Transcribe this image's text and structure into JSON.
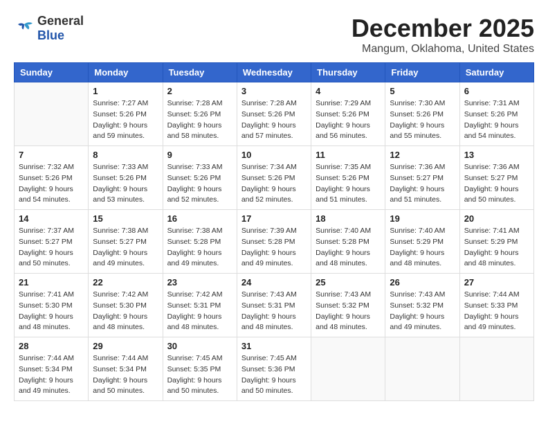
{
  "logo": {
    "general": "General",
    "blue": "Blue"
  },
  "title": {
    "month": "December 2025",
    "location": "Mangum, Oklahoma, United States"
  },
  "headers": [
    "Sunday",
    "Monday",
    "Tuesday",
    "Wednesday",
    "Thursday",
    "Friday",
    "Saturday"
  ],
  "weeks": [
    [
      {
        "day": "",
        "info": ""
      },
      {
        "day": "1",
        "info": "Sunrise: 7:27 AM\nSunset: 5:26 PM\nDaylight: 9 hours\nand 59 minutes."
      },
      {
        "day": "2",
        "info": "Sunrise: 7:28 AM\nSunset: 5:26 PM\nDaylight: 9 hours\nand 58 minutes."
      },
      {
        "day": "3",
        "info": "Sunrise: 7:28 AM\nSunset: 5:26 PM\nDaylight: 9 hours\nand 57 minutes."
      },
      {
        "day": "4",
        "info": "Sunrise: 7:29 AM\nSunset: 5:26 PM\nDaylight: 9 hours\nand 56 minutes."
      },
      {
        "day": "5",
        "info": "Sunrise: 7:30 AM\nSunset: 5:26 PM\nDaylight: 9 hours\nand 55 minutes."
      },
      {
        "day": "6",
        "info": "Sunrise: 7:31 AM\nSunset: 5:26 PM\nDaylight: 9 hours\nand 54 minutes."
      }
    ],
    [
      {
        "day": "7",
        "info": "Sunrise: 7:32 AM\nSunset: 5:26 PM\nDaylight: 9 hours\nand 54 minutes."
      },
      {
        "day": "8",
        "info": "Sunrise: 7:33 AM\nSunset: 5:26 PM\nDaylight: 9 hours\nand 53 minutes."
      },
      {
        "day": "9",
        "info": "Sunrise: 7:33 AM\nSunset: 5:26 PM\nDaylight: 9 hours\nand 52 minutes."
      },
      {
        "day": "10",
        "info": "Sunrise: 7:34 AM\nSunset: 5:26 PM\nDaylight: 9 hours\nand 52 minutes."
      },
      {
        "day": "11",
        "info": "Sunrise: 7:35 AM\nSunset: 5:26 PM\nDaylight: 9 hours\nand 51 minutes."
      },
      {
        "day": "12",
        "info": "Sunrise: 7:36 AM\nSunset: 5:27 PM\nDaylight: 9 hours\nand 51 minutes."
      },
      {
        "day": "13",
        "info": "Sunrise: 7:36 AM\nSunset: 5:27 PM\nDaylight: 9 hours\nand 50 minutes."
      }
    ],
    [
      {
        "day": "14",
        "info": "Sunrise: 7:37 AM\nSunset: 5:27 PM\nDaylight: 9 hours\nand 50 minutes."
      },
      {
        "day": "15",
        "info": "Sunrise: 7:38 AM\nSunset: 5:27 PM\nDaylight: 9 hours\nand 49 minutes."
      },
      {
        "day": "16",
        "info": "Sunrise: 7:38 AM\nSunset: 5:28 PM\nDaylight: 9 hours\nand 49 minutes."
      },
      {
        "day": "17",
        "info": "Sunrise: 7:39 AM\nSunset: 5:28 PM\nDaylight: 9 hours\nand 49 minutes."
      },
      {
        "day": "18",
        "info": "Sunrise: 7:40 AM\nSunset: 5:28 PM\nDaylight: 9 hours\nand 48 minutes."
      },
      {
        "day": "19",
        "info": "Sunrise: 7:40 AM\nSunset: 5:29 PM\nDaylight: 9 hours\nand 48 minutes."
      },
      {
        "day": "20",
        "info": "Sunrise: 7:41 AM\nSunset: 5:29 PM\nDaylight: 9 hours\nand 48 minutes."
      }
    ],
    [
      {
        "day": "21",
        "info": "Sunrise: 7:41 AM\nSunset: 5:30 PM\nDaylight: 9 hours\nand 48 minutes."
      },
      {
        "day": "22",
        "info": "Sunrise: 7:42 AM\nSunset: 5:30 PM\nDaylight: 9 hours\nand 48 minutes."
      },
      {
        "day": "23",
        "info": "Sunrise: 7:42 AM\nSunset: 5:31 PM\nDaylight: 9 hours\nand 48 minutes."
      },
      {
        "day": "24",
        "info": "Sunrise: 7:43 AM\nSunset: 5:31 PM\nDaylight: 9 hours\nand 48 minutes."
      },
      {
        "day": "25",
        "info": "Sunrise: 7:43 AM\nSunset: 5:32 PM\nDaylight: 9 hours\nand 48 minutes."
      },
      {
        "day": "26",
        "info": "Sunrise: 7:43 AM\nSunset: 5:32 PM\nDaylight: 9 hours\nand 49 minutes."
      },
      {
        "day": "27",
        "info": "Sunrise: 7:44 AM\nSunset: 5:33 PM\nDaylight: 9 hours\nand 49 minutes."
      }
    ],
    [
      {
        "day": "28",
        "info": "Sunrise: 7:44 AM\nSunset: 5:34 PM\nDaylight: 9 hours\nand 49 minutes."
      },
      {
        "day": "29",
        "info": "Sunrise: 7:44 AM\nSunset: 5:34 PM\nDaylight: 9 hours\nand 50 minutes."
      },
      {
        "day": "30",
        "info": "Sunrise: 7:45 AM\nSunset: 5:35 PM\nDaylight: 9 hours\nand 50 minutes."
      },
      {
        "day": "31",
        "info": "Sunrise: 7:45 AM\nSunset: 5:36 PM\nDaylight: 9 hours\nand 50 minutes."
      },
      {
        "day": "",
        "info": ""
      },
      {
        "day": "",
        "info": ""
      },
      {
        "day": "",
        "info": ""
      }
    ]
  ]
}
